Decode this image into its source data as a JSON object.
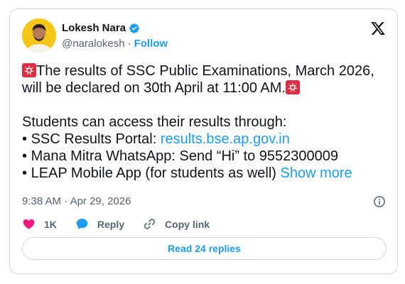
{
  "author": {
    "name": "Lokesh Nara",
    "handle": "@naralokesh",
    "separator": "·",
    "follow_label": "Follow"
  },
  "post": {
    "line1": "The results of SSC Public Examinations, March 2026,",
    "line2": "will be declared on 30th April at 11:00 AM.",
    "line3": "Students can access their results through:",
    "bullet": "•",
    "item1_text": "SSC Results Portal:",
    "item1_link": "results.bse.ap.gov.in",
    "item2_text": "Mana Mitra WhatsApp: Send “Hi” to 9552300009",
    "item3_text": "LEAP Mobile App (for students as well)",
    "show_more": "Show more"
  },
  "meta": {
    "time": "9:38 AM",
    "separator": "·",
    "date": "Apr 29, 2026"
  },
  "actions": {
    "like_count": "1K",
    "reply_label": "Reply",
    "copy_link_label": "Copy link"
  },
  "read_replies": "Read 24 replies",
  "colors": {
    "accent": "#1d9bf0",
    "like": "#f91880",
    "muted": "#536471",
    "border": "#cfd9de",
    "avatar_bg": "#f5c518"
  },
  "icons": {
    "verified": "verified-badge-icon",
    "platform": "x-logo-icon",
    "siren": "police-light-icon",
    "info": "info-icon",
    "like": "heart-icon",
    "reply": "speech-bubble-icon",
    "copy_link": "link-icon"
  }
}
